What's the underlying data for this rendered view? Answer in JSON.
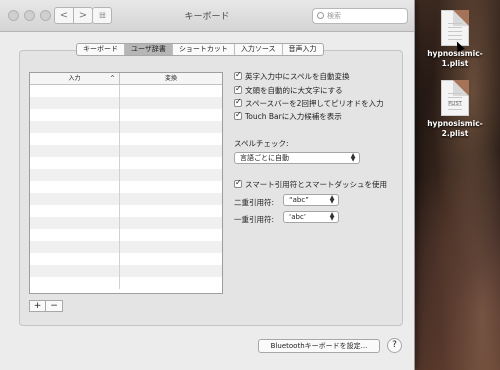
{
  "window": {
    "title": "キーボード",
    "search_placeholder": "検索",
    "nav": {
      "back": "<",
      "forward": ">",
      "grid": "⁞⁞⁞⁞"
    }
  },
  "tabs": [
    {
      "label": "キーボード"
    },
    {
      "label": "ユーザ辞書",
      "active": true
    },
    {
      "label": "ショートカット"
    },
    {
      "label": "入力ソース"
    },
    {
      "label": "音声入力"
    }
  ],
  "table": {
    "col_input": "入力",
    "col_convert": "変換",
    "sort_indicator": "^"
  },
  "buttons": {
    "add": "+",
    "remove": "−"
  },
  "options": {
    "auto_spell": "英字入力中にスペルを自動変換",
    "auto_capital": "文頭を自動的に大文字にする",
    "double_space_period": "スペースバーを2回押してピリオドを入力",
    "touchbar_suggest": "Touch Barに入力候補を表示"
  },
  "spellcheck": {
    "label": "スペルチェック:",
    "value": "言語ごとに自動"
  },
  "smart_quotes": {
    "label": "スマート引用符とスマートダッシュを使用",
    "double_label": "二重引用符:",
    "double_value": "“abc”",
    "single_label": "一重引用符:",
    "single_value": "‘abc’"
  },
  "footer": {
    "bluetooth_button": "Bluetoothキーボードを設定...",
    "help": "?"
  },
  "desktop": {
    "files": [
      {
        "name": "hypnosismic-1.plist",
        "tag": ""
      },
      {
        "name": "hypnosismic-2.plist",
        "tag": "PLIST"
      }
    ]
  }
}
